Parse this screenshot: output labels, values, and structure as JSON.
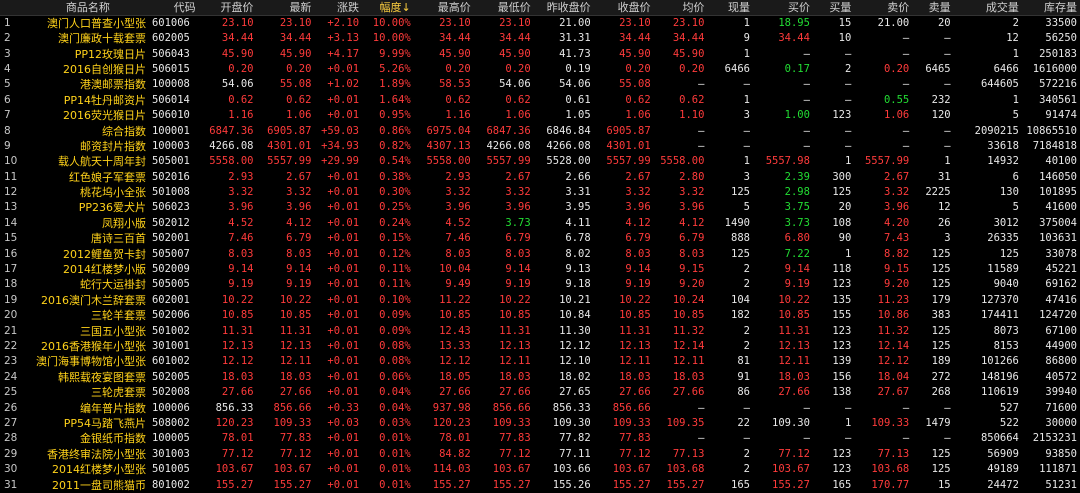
{
  "colors": {
    "up": "#ff3b3b",
    "down": "#22dd33",
    "flat": "#e8e8e8",
    "name": "#ffd21a"
  },
  "headers": [
    "",
    "商品名称",
    "代码",
    "开盘价",
    "最新",
    "涨跌",
    "幅度↓",
    "最高价",
    "最低价",
    "昨收盘价",
    "收盘价",
    "均价",
    "现量",
    "买价",
    "买量",
    "卖价",
    "卖量",
    "成交量",
    "库存量"
  ],
  "sort_column": "幅度↓",
  "rows": [
    {
      "idx": "1",
      "name": "澳门人口普查小型张",
      "code": "601006",
      "open": "23.10",
      "last": "23.10",
      "chg": "+2.10",
      "pct": "10.00%",
      "high": "23.10",
      "low": "23.10",
      "prev": "21.00",
      "close": "23.10",
      "avg": "23.10",
      "vol": "1",
      "bid": "18.95",
      "bidq": "15",
      "ask": "21.00",
      "askq": "20",
      "tv": "2",
      "stock": "33500",
      "dir": "up",
      "bidc": "dn",
      "askc": "fl"
    },
    {
      "idx": "2",
      "name": "澳门廉政十载套票",
      "code": "602005",
      "open": "34.44",
      "last": "34.44",
      "chg": "+3.13",
      "pct": "10.00%",
      "high": "34.44",
      "low": "34.44",
      "prev": "31.31",
      "close": "34.44",
      "avg": "34.44",
      "vol": "9",
      "bid": "34.44",
      "bidq": "10",
      "ask": "—",
      "askq": "—",
      "tv": "12",
      "stock": "56250",
      "dir": "up",
      "bidc": "up",
      "askc": "fl"
    },
    {
      "idx": "3",
      "name": "PP12玫瑰日片",
      "code": "506043",
      "open": "45.90",
      "last": "45.90",
      "chg": "+4.17",
      "pct": "9.99%",
      "high": "45.90",
      "low": "45.90",
      "prev": "41.73",
      "close": "45.90",
      "avg": "45.90",
      "vol": "1",
      "bid": "—",
      "bidq": "—",
      "ask": "—",
      "askq": "—",
      "tv": "1",
      "stock": "250183",
      "dir": "up",
      "bidc": "fl",
      "askc": "fl"
    },
    {
      "idx": "4",
      "name": "2016自创猴日片",
      "code": "506015",
      "open": "0.20",
      "last": "0.20",
      "chg": "+0.01",
      "pct": "5.26%",
      "high": "0.20",
      "low": "0.20",
      "prev": "0.19",
      "close": "0.20",
      "avg": "0.20",
      "vol": "6466",
      "bid": "0.17",
      "bidq": "2",
      "ask": "0.20",
      "askq": "6465",
      "tv": "6466",
      "stock": "1616000",
      "dir": "up",
      "bidc": "dn",
      "askc": "up"
    },
    {
      "idx": "5",
      "name": "港澳邮票指数",
      "code": "100008",
      "open": "54.06",
      "last": "55.08",
      "chg": "+1.02",
      "pct": "1.89%",
      "high": "58.53",
      "low": "54.06",
      "prev": "54.06",
      "close": "55.08",
      "avg": "—",
      "vol": "—",
      "bid": "—",
      "bidq": "—",
      "ask": "—",
      "askq": "—",
      "tv": "644605",
      "stock": "572216",
      "dir": "up",
      "bidc": "fl",
      "askc": "fl",
      "openc": "fl",
      "lowc": "fl"
    },
    {
      "idx": "6",
      "name": "PP14牡丹邮资片",
      "code": "506014",
      "open": "0.62",
      "last": "0.62",
      "chg": "+0.01",
      "pct": "1.64%",
      "high": "0.62",
      "low": "0.62",
      "prev": "0.61",
      "close": "0.62",
      "avg": "0.62",
      "vol": "1",
      "bid": "—",
      "bidq": "—",
      "ask": "0.55",
      "askq": "232",
      "tv": "1",
      "stock": "340561",
      "dir": "up",
      "bidc": "fl",
      "askc": "dn"
    },
    {
      "idx": "7",
      "name": "2016荧光猴日片",
      "code": "506010",
      "open": "1.16",
      "last": "1.06",
      "chg": "+0.01",
      "pct": "0.95%",
      "high": "1.16",
      "low": "1.06",
      "prev": "1.05",
      "close": "1.06",
      "avg": "1.10",
      "vol": "3",
      "bid": "1.00",
      "bidq": "123",
      "ask": "1.06",
      "askq": "120",
      "tv": "5",
      "stock": "91474",
      "dir": "up",
      "bidc": "dn",
      "askc": "up"
    },
    {
      "idx": "8",
      "name": "综合指数",
      "code": "100001",
      "open": "6847.36",
      "last": "6905.87",
      "chg": "+59.03",
      "pct": "0.86%",
      "high": "6975.04",
      "low": "6847.36",
      "prev": "6846.84",
      "close": "6905.87",
      "avg": "—",
      "vol": "—",
      "bid": "—",
      "bidq": "—",
      "ask": "—",
      "askq": "—",
      "tv": "2090215",
      "stock": "10865510",
      "dir": "up",
      "bidc": "fl",
      "askc": "fl"
    },
    {
      "idx": "9",
      "name": "邮资封片指数",
      "code": "100003",
      "open": "4266.08",
      "last": "4301.01",
      "chg": "+34.93",
      "pct": "0.82%",
      "high": "4307.13",
      "low": "4266.08",
      "prev": "4266.08",
      "close": "4301.01",
      "avg": "—",
      "vol": "—",
      "bid": "—",
      "bidq": "—",
      "ask": "—",
      "askq": "—",
      "tv": "33618",
      "stock": "7184818",
      "dir": "up",
      "bidc": "fl",
      "askc": "fl",
      "openc": "fl",
      "lowc": "fl"
    },
    {
      "idx": "10",
      "name": "载人航天十周年封",
      "code": "505001",
      "open": "5558.00",
      "last": "5557.99",
      "chg": "+29.99",
      "pct": "0.54%",
      "high": "5558.00",
      "low": "5557.99",
      "prev": "5528.00",
      "close": "5557.99",
      "avg": "5558.00",
      "vol": "1",
      "bid": "5557.98",
      "bidq": "1",
      "ask": "5557.99",
      "askq": "1",
      "tv": "14932",
      "stock": "40100",
      "dir": "up",
      "bidc": "up",
      "askc": "up"
    },
    {
      "idx": "11",
      "name": "红色娘子军套票",
      "code": "502016",
      "open": "2.93",
      "last": "2.67",
      "chg": "+0.01",
      "pct": "0.38%",
      "high": "2.93",
      "low": "2.67",
      "prev": "2.66",
      "close": "2.67",
      "avg": "2.80",
      "vol": "3",
      "bid": "2.39",
      "bidq": "300",
      "ask": "2.67",
      "askq": "31",
      "tv": "6",
      "stock": "146050",
      "dir": "up",
      "bidc": "dn",
      "askc": "up"
    },
    {
      "idx": "12",
      "name": "桃花坞小全张",
      "code": "501008",
      "open": "3.32",
      "last": "3.32",
      "chg": "+0.01",
      "pct": "0.30%",
      "high": "3.32",
      "low": "3.32",
      "prev": "3.31",
      "close": "3.32",
      "avg": "3.32",
      "vol": "125",
      "bid": "2.98",
      "bidq": "125",
      "ask": "3.32",
      "askq": "2225",
      "tv": "130",
      "stock": "101895",
      "dir": "up",
      "bidc": "dn",
      "askc": "up"
    },
    {
      "idx": "13",
      "name": "PP236爱犬片",
      "code": "506023",
      "open": "3.96",
      "last": "3.96",
      "chg": "+0.01",
      "pct": "0.25%",
      "high": "3.96",
      "low": "3.96",
      "prev": "3.95",
      "close": "3.96",
      "avg": "3.96",
      "vol": "5",
      "bid": "3.75",
      "bidq": "20",
      "ask": "3.96",
      "askq": "12",
      "tv": "5",
      "stock": "41600",
      "dir": "up",
      "bidc": "dn",
      "askc": "up"
    },
    {
      "idx": "14",
      "name": "凤翔小版",
      "code": "502012",
      "open": "4.52",
      "last": "4.12",
      "chg": "+0.01",
      "pct": "0.24%",
      "high": "4.52",
      "low": "3.73",
      "prev": "4.11",
      "close": "4.12",
      "avg": "4.12",
      "vol": "1490",
      "bid": "3.73",
      "bidq": "108",
      "ask": "4.20",
      "askq": "26",
      "tv": "3012",
      "stock": "375004",
      "dir": "up",
      "bidc": "dn",
      "askc": "up",
      "lowc": "dn"
    },
    {
      "idx": "15",
      "name": "唐诗三百首",
      "code": "502001",
      "open": "7.46",
      "last": "6.79",
      "chg": "+0.01",
      "pct": "0.15%",
      "high": "7.46",
      "low": "6.79",
      "prev": "6.78",
      "close": "6.79",
      "avg": "6.79",
      "vol": "888",
      "bid": "6.80",
      "bidq": "90",
      "ask": "7.43",
      "askq": "3",
      "tv": "26335",
      "stock": "103631",
      "dir": "up",
      "bidc": "up",
      "askc": "up"
    },
    {
      "idx": "16",
      "name": "2012鲤鱼贺卡封",
      "code": "505007",
      "open": "8.03",
      "last": "8.03",
      "chg": "+0.01",
      "pct": "0.12%",
      "high": "8.03",
      "low": "8.03",
      "prev": "8.02",
      "close": "8.03",
      "avg": "8.03",
      "vol": "125",
      "bid": "7.22",
      "bidq": "1",
      "ask": "8.82",
      "askq": "125",
      "tv": "125",
      "stock": "33078",
      "dir": "up",
      "bidc": "dn",
      "askc": "up"
    },
    {
      "idx": "17",
      "name": "2014红楼梦小版",
      "code": "502009",
      "open": "9.14",
      "last": "9.14",
      "chg": "+0.01",
      "pct": "0.11%",
      "high": "10.04",
      "low": "9.14",
      "prev": "9.13",
      "close": "9.14",
      "avg": "9.15",
      "vol": "2",
      "bid": "9.14",
      "bidq": "118",
      "ask": "9.15",
      "askq": "125",
      "tv": "11589",
      "stock": "45221",
      "dir": "up",
      "bidc": "up",
      "askc": "up"
    },
    {
      "idx": "18",
      "name": "蛇行大运褂封",
      "code": "505005",
      "open": "9.19",
      "last": "9.19",
      "chg": "+0.01",
      "pct": "0.11%",
      "high": "9.49",
      "low": "9.19",
      "prev": "9.18",
      "close": "9.19",
      "avg": "9.20",
      "vol": "2",
      "bid": "9.19",
      "bidq": "123",
      "ask": "9.20",
      "askq": "125",
      "tv": "9040",
      "stock": "69162",
      "dir": "up",
      "bidc": "up",
      "askc": "up"
    },
    {
      "idx": "19",
      "name": "2016澳门木兰辞套票",
      "code": "602001",
      "open": "10.22",
      "last": "10.22",
      "chg": "+0.01",
      "pct": "0.10%",
      "high": "11.22",
      "low": "10.22",
      "prev": "10.21",
      "close": "10.22",
      "avg": "10.24",
      "vol": "104",
      "bid": "10.22",
      "bidq": "135",
      "ask": "11.23",
      "askq": "179",
      "tv": "127370",
      "stock": "47416",
      "dir": "up",
      "bidc": "up",
      "askc": "up"
    },
    {
      "idx": "20",
      "name": "三轮羊套票",
      "code": "502006",
      "open": "10.85",
      "last": "10.85",
      "chg": "+0.01",
      "pct": "0.09%",
      "high": "10.85",
      "low": "10.85",
      "prev": "10.84",
      "close": "10.85",
      "avg": "10.85",
      "vol": "182",
      "bid": "10.85",
      "bidq": "155",
      "ask": "10.86",
      "askq": "383",
      "tv": "174411",
      "stock": "124720",
      "dir": "up",
      "bidc": "up",
      "askc": "up"
    },
    {
      "idx": "21",
      "name": "三国五小型张",
      "code": "501002",
      "open": "11.31",
      "last": "11.31",
      "chg": "+0.01",
      "pct": "0.09%",
      "high": "12.43",
      "low": "11.31",
      "prev": "11.30",
      "close": "11.31",
      "avg": "11.32",
      "vol": "2",
      "bid": "11.31",
      "bidq": "123",
      "ask": "11.32",
      "askq": "125",
      "tv": "8073",
      "stock": "67100",
      "dir": "up",
      "bidc": "up",
      "askc": "up"
    },
    {
      "idx": "22",
      "name": "2016香港猴年小型张",
      "code": "301001",
      "open": "12.13",
      "last": "12.13",
      "chg": "+0.01",
      "pct": "0.08%",
      "high": "13.33",
      "low": "12.13",
      "prev": "12.12",
      "close": "12.13",
      "avg": "12.14",
      "vol": "2",
      "bid": "12.13",
      "bidq": "123",
      "ask": "12.14",
      "askq": "125",
      "tv": "8153",
      "stock": "44900",
      "dir": "up",
      "bidc": "up",
      "askc": "up"
    },
    {
      "idx": "23",
      "name": "澳门海事博物馆小型张",
      "code": "601002",
      "open": "12.12",
      "last": "12.11",
      "chg": "+0.01",
      "pct": "0.08%",
      "high": "12.12",
      "low": "12.11",
      "prev": "12.10",
      "close": "12.11",
      "avg": "12.11",
      "vol": "81",
      "bid": "12.11",
      "bidq": "139",
      "ask": "12.12",
      "askq": "189",
      "tv": "101266",
      "stock": "86800",
      "dir": "up",
      "bidc": "up",
      "askc": "up"
    },
    {
      "idx": "24",
      "name": "韩熙载夜宴图套票",
      "code": "502005",
      "open": "18.03",
      "last": "18.03",
      "chg": "+0.01",
      "pct": "0.06%",
      "high": "18.05",
      "low": "18.03",
      "prev": "18.02",
      "close": "18.03",
      "avg": "18.03",
      "vol": "91",
      "bid": "18.03",
      "bidq": "156",
      "ask": "18.04",
      "askq": "272",
      "tv": "148196",
      "stock": "40572",
      "dir": "up",
      "bidc": "up",
      "askc": "up"
    },
    {
      "idx": "25",
      "name": "三轮虎套票",
      "code": "502008",
      "open": "27.66",
      "last": "27.66",
      "chg": "+0.01",
      "pct": "0.04%",
      "high": "27.66",
      "low": "27.66",
      "prev": "27.65",
      "close": "27.66",
      "avg": "27.66",
      "vol": "86",
      "bid": "27.66",
      "bidq": "138",
      "ask": "27.67",
      "askq": "268",
      "tv": "110619",
      "stock": "39940",
      "dir": "up",
      "bidc": "up",
      "askc": "up"
    },
    {
      "idx": "26",
      "name": "编年普片指数",
      "code": "100006",
      "open": "856.33",
      "last": "856.66",
      "chg": "+0.33",
      "pct": "0.04%",
      "high": "937.98",
      "low": "856.66",
      "prev": "856.33",
      "close": "856.66",
      "avg": "—",
      "vol": "—",
      "bid": "—",
      "bidq": "—",
      "ask": "—",
      "askq": "—",
      "tv": "527",
      "stock": "71600",
      "dir": "up",
      "bidc": "fl",
      "askc": "fl",
      "openc": "fl"
    },
    {
      "idx": "27",
      "name": "PP54马踏飞燕片",
      "code": "508002",
      "open": "120.23",
      "last": "109.33",
      "chg": "+0.03",
      "pct": "0.03%",
      "high": "120.23",
      "low": "109.33",
      "prev": "109.30",
      "close": "109.33",
      "avg": "109.35",
      "vol": "22",
      "bid": "109.30",
      "bidq": "1",
      "ask": "109.33",
      "askq": "1479",
      "tv": "522",
      "stock": "30000",
      "dir": "up",
      "bidc": "fl",
      "askc": "up"
    },
    {
      "idx": "28",
      "name": "金银纸币指数",
      "code": "100005",
      "open": "78.01",
      "last": "77.83",
      "chg": "+0.01",
      "pct": "0.01%",
      "high": "78.01",
      "low": "77.83",
      "prev": "77.82",
      "close": "77.83",
      "avg": "—",
      "vol": "—",
      "bid": "—",
      "bidq": "—",
      "ask": "—",
      "askq": "—",
      "tv": "850664",
      "stock": "2153231",
      "dir": "up",
      "bidc": "fl",
      "askc": "fl"
    },
    {
      "idx": "29",
      "name": "香港终审法院小型张",
      "code": "301003",
      "open": "77.12",
      "last": "77.12",
      "chg": "+0.01",
      "pct": "0.01%",
      "high": "84.82",
      "low": "77.12",
      "prev": "77.11",
      "close": "77.12",
      "avg": "77.13",
      "vol": "2",
      "bid": "77.12",
      "bidq": "123",
      "ask": "77.13",
      "askq": "125",
      "tv": "56909",
      "stock": "93850",
      "dir": "up",
      "bidc": "up",
      "askc": "up"
    },
    {
      "idx": "30",
      "name": "2014红楼梦小型张",
      "code": "501005",
      "open": "103.67",
      "last": "103.67",
      "chg": "+0.01",
      "pct": "0.01%",
      "high": "114.03",
      "low": "103.67",
      "prev": "103.66",
      "close": "103.67",
      "avg": "103.68",
      "vol": "2",
      "bid": "103.67",
      "bidq": "123",
      "ask": "103.68",
      "askq": "125",
      "tv": "49189",
      "stock": "111871",
      "dir": "up",
      "bidc": "up",
      "askc": "up"
    },
    {
      "idx": "31",
      "name": "2011一盘司熊猫币",
      "code": "801002",
      "open": "155.27",
      "last": "155.27",
      "chg": "+0.01",
      "pct": "0.01%",
      "high": "155.27",
      "low": "155.27",
      "prev": "155.26",
      "close": "155.27",
      "avg": "155.27",
      "vol": "165",
      "bid": "155.27",
      "bidq": "165",
      "ask": "170.77",
      "askq": "15",
      "tv": "24472",
      "stock": "51231",
      "dir": "up",
      "bidc": "up",
      "askc": "up"
    }
  ]
}
